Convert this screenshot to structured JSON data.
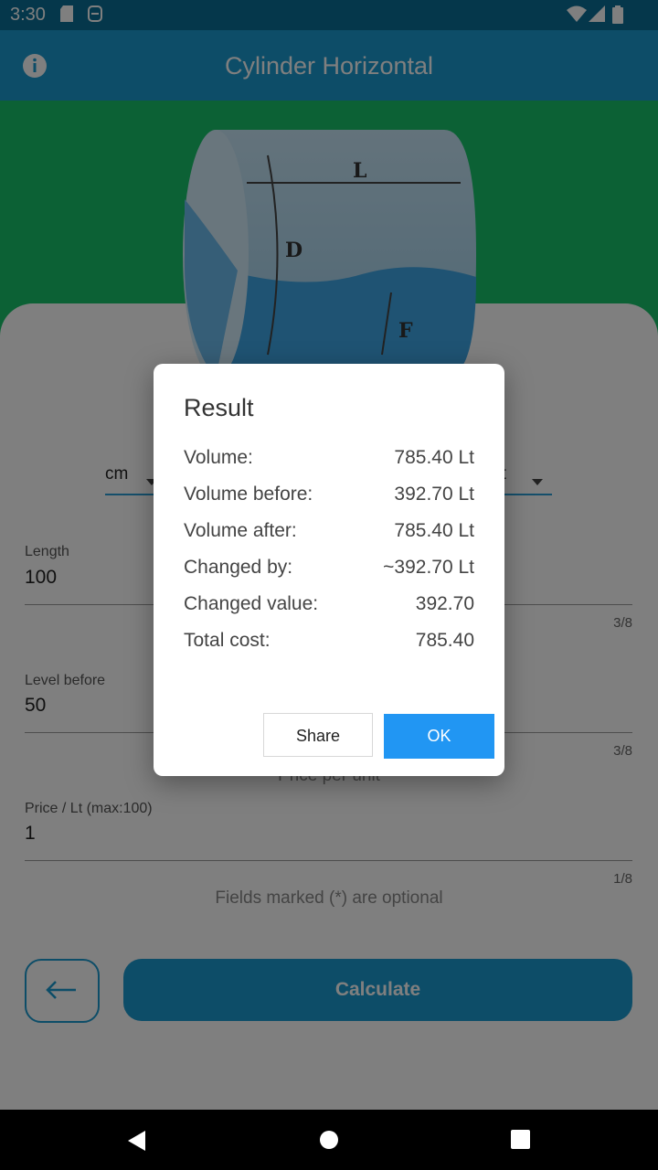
{
  "status_bar": {
    "time": "3:30"
  },
  "app_bar": {
    "title": "Cylinder Horizontal"
  },
  "cylinder": {
    "label_length": "L",
    "label_diameter": "D",
    "label_fill": "F"
  },
  "form": {
    "unit_left": "cm",
    "unit_right": "Lt",
    "fields": [
      {
        "label": "Length",
        "value": "100",
        "counter": "3/8"
      },
      {
        "label": "Level before",
        "value": "50",
        "counter": "3/8"
      },
      {
        "label": "Price / Lt (max:100)",
        "value": "1",
        "counter": "1/8"
      }
    ],
    "price_per_unit_hint": "Price per unit",
    "optional_note": "Fields marked (*) are optional",
    "calculate_label": "Calculate"
  },
  "dialog": {
    "title": "Result",
    "rows": [
      {
        "label": "Volume:",
        "value": "785.40 Lt"
      },
      {
        "label": "Volume before:",
        "value": "392.70 Lt"
      },
      {
        "label": "Volume after:",
        "value": "785.40 Lt"
      },
      {
        "label": "Changed by:",
        "value": "~392.70 Lt"
      },
      {
        "label": "Changed value:",
        "value": "392.70"
      },
      {
        "label": "Total cost:",
        "value": "785.40"
      }
    ],
    "share_label": "Share",
    "ok_label": "OK"
  },
  "colors": {
    "primary": "#1b9bd0",
    "hero_green": "#18c36b",
    "ok_button": "#2196f3"
  },
  "icons": [
    "sd-card-icon",
    "notification-icon",
    "wifi-icon",
    "signal-icon",
    "battery-icon",
    "info-icon",
    "back-arrow-icon",
    "nav-back-icon",
    "nav-home-icon",
    "nav-recents-icon"
  ]
}
